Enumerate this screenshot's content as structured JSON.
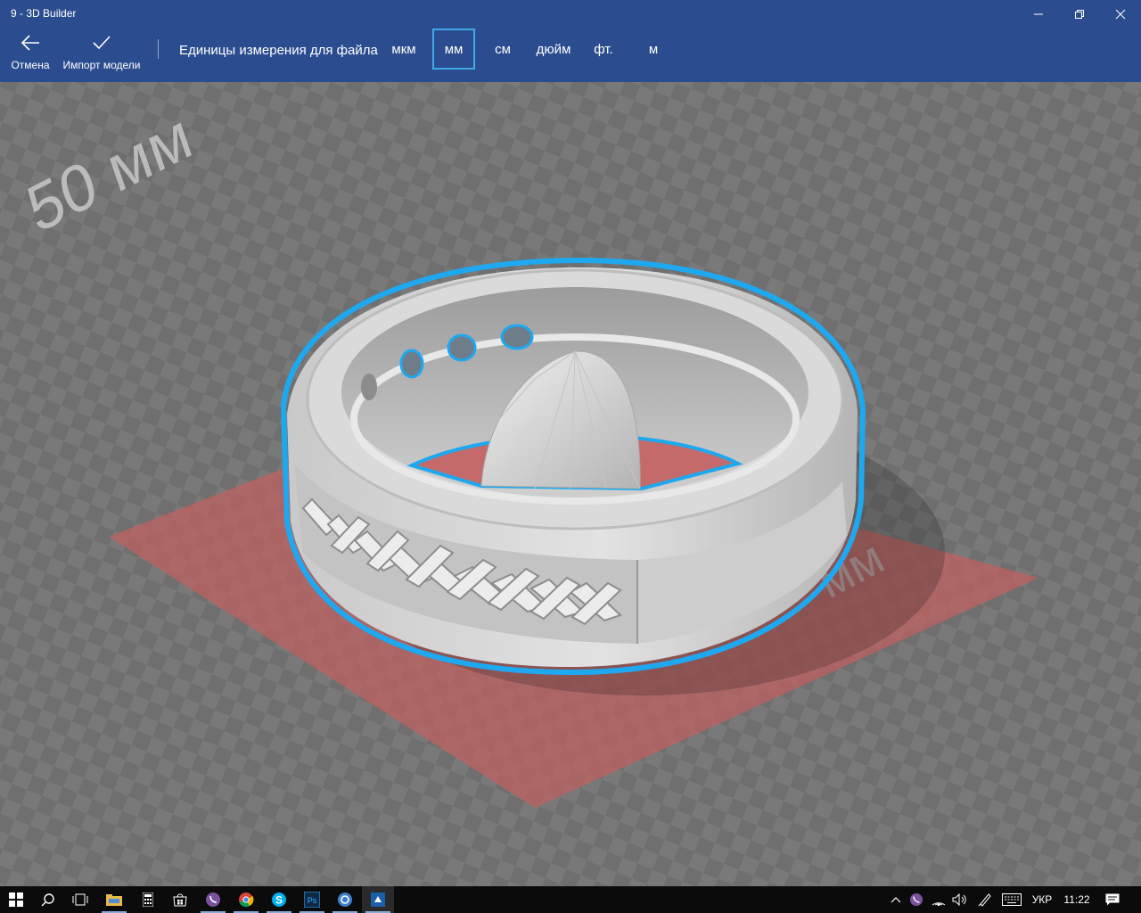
{
  "window": {
    "title": "9 - 3D Builder"
  },
  "commands": {
    "cancel_label": "Отмена",
    "import_label": "Импорт модели"
  },
  "units": {
    "label": "Единицы измерения для файла",
    "options": [
      "мкм",
      "мм",
      "см",
      "дюйм",
      "фт.",
      "м"
    ],
    "selected": "мм"
  },
  "scene": {
    "ruler_label_left": "50 мм",
    "ruler_label_right": "мм",
    "model": "ring",
    "colors": {
      "background": "#7c7c7c",
      "plate": "#c15f5f",
      "selection_outline": "#1ea8f0",
      "model": "#d6d6d6",
      "header": "#2b4d8f"
    }
  },
  "taskbar": {
    "apps": [
      "start-icon",
      "search-icon",
      "task-view-icon",
      "file-explorer-icon",
      "calculator-icon",
      "store-icon",
      "viber-icon",
      "chrome-icon",
      "skype-icon",
      "photoshop-icon",
      "app-icon",
      "3d-builder-icon"
    ],
    "language": "УКР",
    "time": "11:22"
  }
}
